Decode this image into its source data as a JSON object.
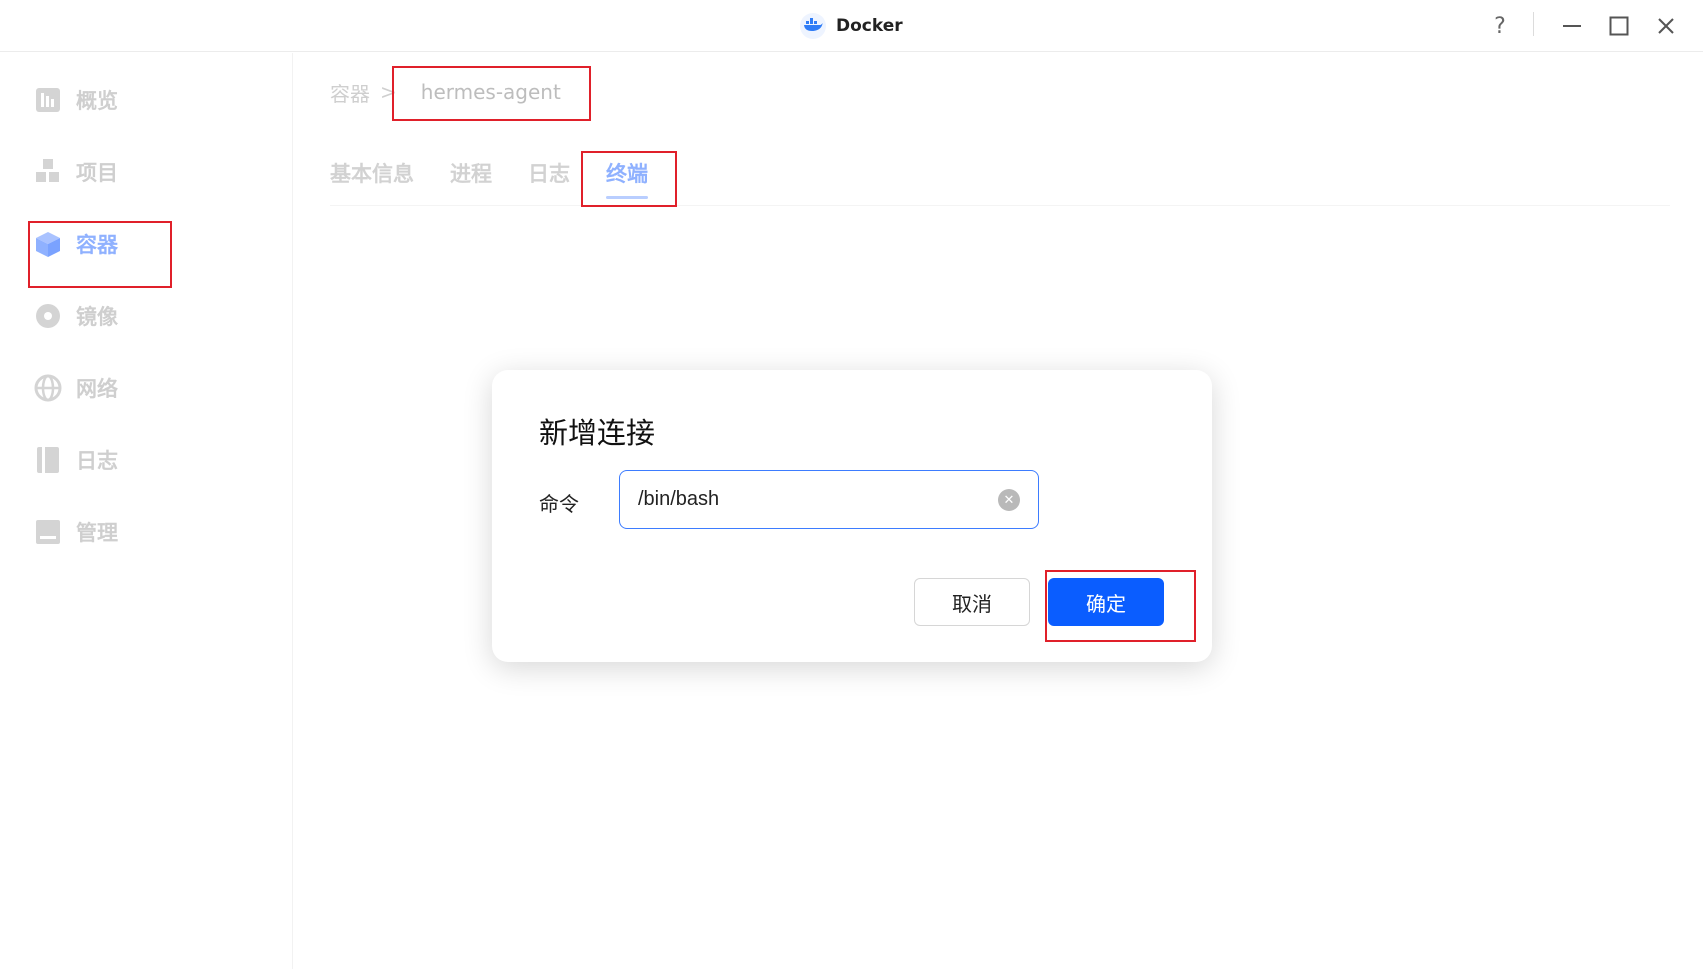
{
  "window": {
    "title": "Docker",
    "controls": {
      "help": "?",
      "minimize": "—",
      "maximize": "☐",
      "close": "✕"
    }
  },
  "sidebar": {
    "items": [
      {
        "label": "概览",
        "icon": "overview-icon",
        "active": false
      },
      {
        "label": "项目",
        "icon": "project-icon",
        "active": false
      },
      {
        "label": "容器",
        "icon": "container-icon",
        "active": true
      },
      {
        "label": "镜像",
        "icon": "image-icon",
        "active": false
      },
      {
        "label": "网络",
        "icon": "network-icon",
        "active": false
      },
      {
        "label": "日志",
        "icon": "log-icon",
        "active": false
      },
      {
        "label": "管理",
        "icon": "manage-icon",
        "active": false
      }
    ]
  },
  "breadcrumb": {
    "parent": "容器",
    "separator": ">",
    "current": "hermes-agent"
  },
  "tabs": [
    {
      "label": "基本信息",
      "active": false
    },
    {
      "label": "进程",
      "active": false
    },
    {
      "label": "日志",
      "active": false
    },
    {
      "label": "终端",
      "active": true
    }
  ],
  "dialog": {
    "title": "新增连接",
    "command_label": "命令",
    "command_value": "/bin/bash",
    "cancel_label": "取消",
    "confirm_label": "确定"
  },
  "colors": {
    "accent": "#0a5dff",
    "active_nav": "#8fb1ff",
    "annotation": "#e0202a"
  }
}
